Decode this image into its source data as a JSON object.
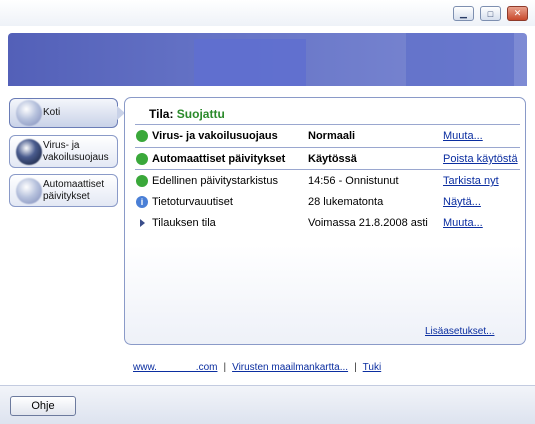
{
  "window": {
    "minimize": "▁",
    "maximize": "□",
    "close": "✕"
  },
  "nav": {
    "items": [
      {
        "label": "Koti",
        "active": true
      },
      {
        "label": "Virus- ja vakoilusuojaus",
        "active": false
      },
      {
        "label": "Automaattiset päivitykset",
        "active": false
      }
    ]
  },
  "status": {
    "label": "Tila:",
    "value": "Suojattu",
    "rows": [
      {
        "icon": "check-icon",
        "name": "Virus- ja vakoilusuojaus",
        "value": "Normaali",
        "action": "Muuta..."
      },
      {
        "icon": "check-icon",
        "name": "Automaattiset päivitykset",
        "value": "Käytössä",
        "action": "Poista käytöstä"
      },
      {
        "icon": "check-icon",
        "name": "Edellinen päivitystarkistus",
        "value": "14:56 - Onnistunut",
        "action": "Tarkista nyt"
      },
      {
        "icon": "info-icon",
        "name": "Tietoturvauutiset",
        "value": "28 lukematonta",
        "action": "Näytä..."
      },
      {
        "icon": "arrow-icon",
        "name": "Tilauksen tila",
        "value": "Voimassa 21.8.2008 asti",
        "action": "Muuta..."
      }
    ],
    "more": "Lisäasetukset..."
  },
  "footer": {
    "link1": "www.              .com",
    "link2": "Virusten maailmankartta...",
    "link3": "Tuki",
    "separator": "|"
  },
  "bottom": {
    "help": "Ohje"
  },
  "colors": {
    "status_ok": "#2a8a2a",
    "link": "#0b2ea0",
    "banner": "#5360b8"
  }
}
